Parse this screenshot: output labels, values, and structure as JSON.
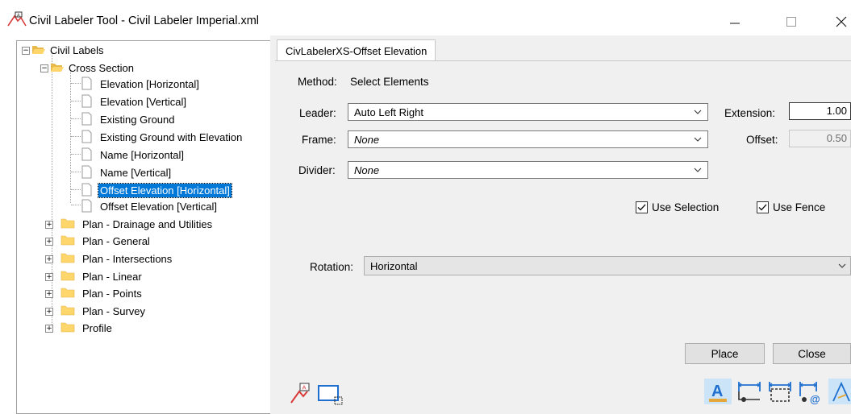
{
  "window": {
    "title": "Civil Labeler Tool - Civil Labeler Imperial.xml",
    "minimize_glyph": "—",
    "close_glyph": "✕"
  },
  "tree": {
    "root": "Civil Labels",
    "cross_section": {
      "label": "Cross Section",
      "items": [
        "Elevation [Horizontal]",
        "Elevation [Vertical]",
        "Existing Ground",
        "Existing Ground with Elevation",
        "Name [Horizontal]",
        "Name [Vertical]",
        "Offset Elevation [Horizontal]",
        "Offset Elevation [Vertical]"
      ]
    },
    "groups": [
      "Plan - Drainage and Utilities",
      "Plan - General",
      "Plan - Intersections",
      "Plan - Linear",
      "Plan - Points",
      "Plan - Survey",
      "Profile"
    ],
    "expanded_glyph": "−",
    "collapsed_glyph": "+"
  },
  "tab": {
    "label": "CivLabelerXS-Offset Elevation"
  },
  "form": {
    "method_label": "Method:",
    "method_value": "Select Elements",
    "leader_label": "Leader:",
    "leader_value": "Auto Left Right",
    "frame_label": "Frame:",
    "frame_value": "None",
    "divider_label": "Divider:",
    "divider_value": "None",
    "extension_label": "Extension:",
    "extension_value": "1.00",
    "offset_label": "Offset:",
    "offset_value": "0.50",
    "use_selection_label": "Use Selection",
    "use_selection_checked": true,
    "use_fence_label": "Use Fence",
    "use_fence_checked": true,
    "rotation_label": "Rotation:",
    "rotation_value": "Horizontal"
  },
  "buttons": {
    "place": "Place",
    "close": "Close"
  },
  "colors": {
    "selection": "#0078d7",
    "folder": "#ffd66b",
    "icon_red": "#d83b3b",
    "icon_blue": "#1f6fd0",
    "toggle_bg": "#cce4f7"
  }
}
